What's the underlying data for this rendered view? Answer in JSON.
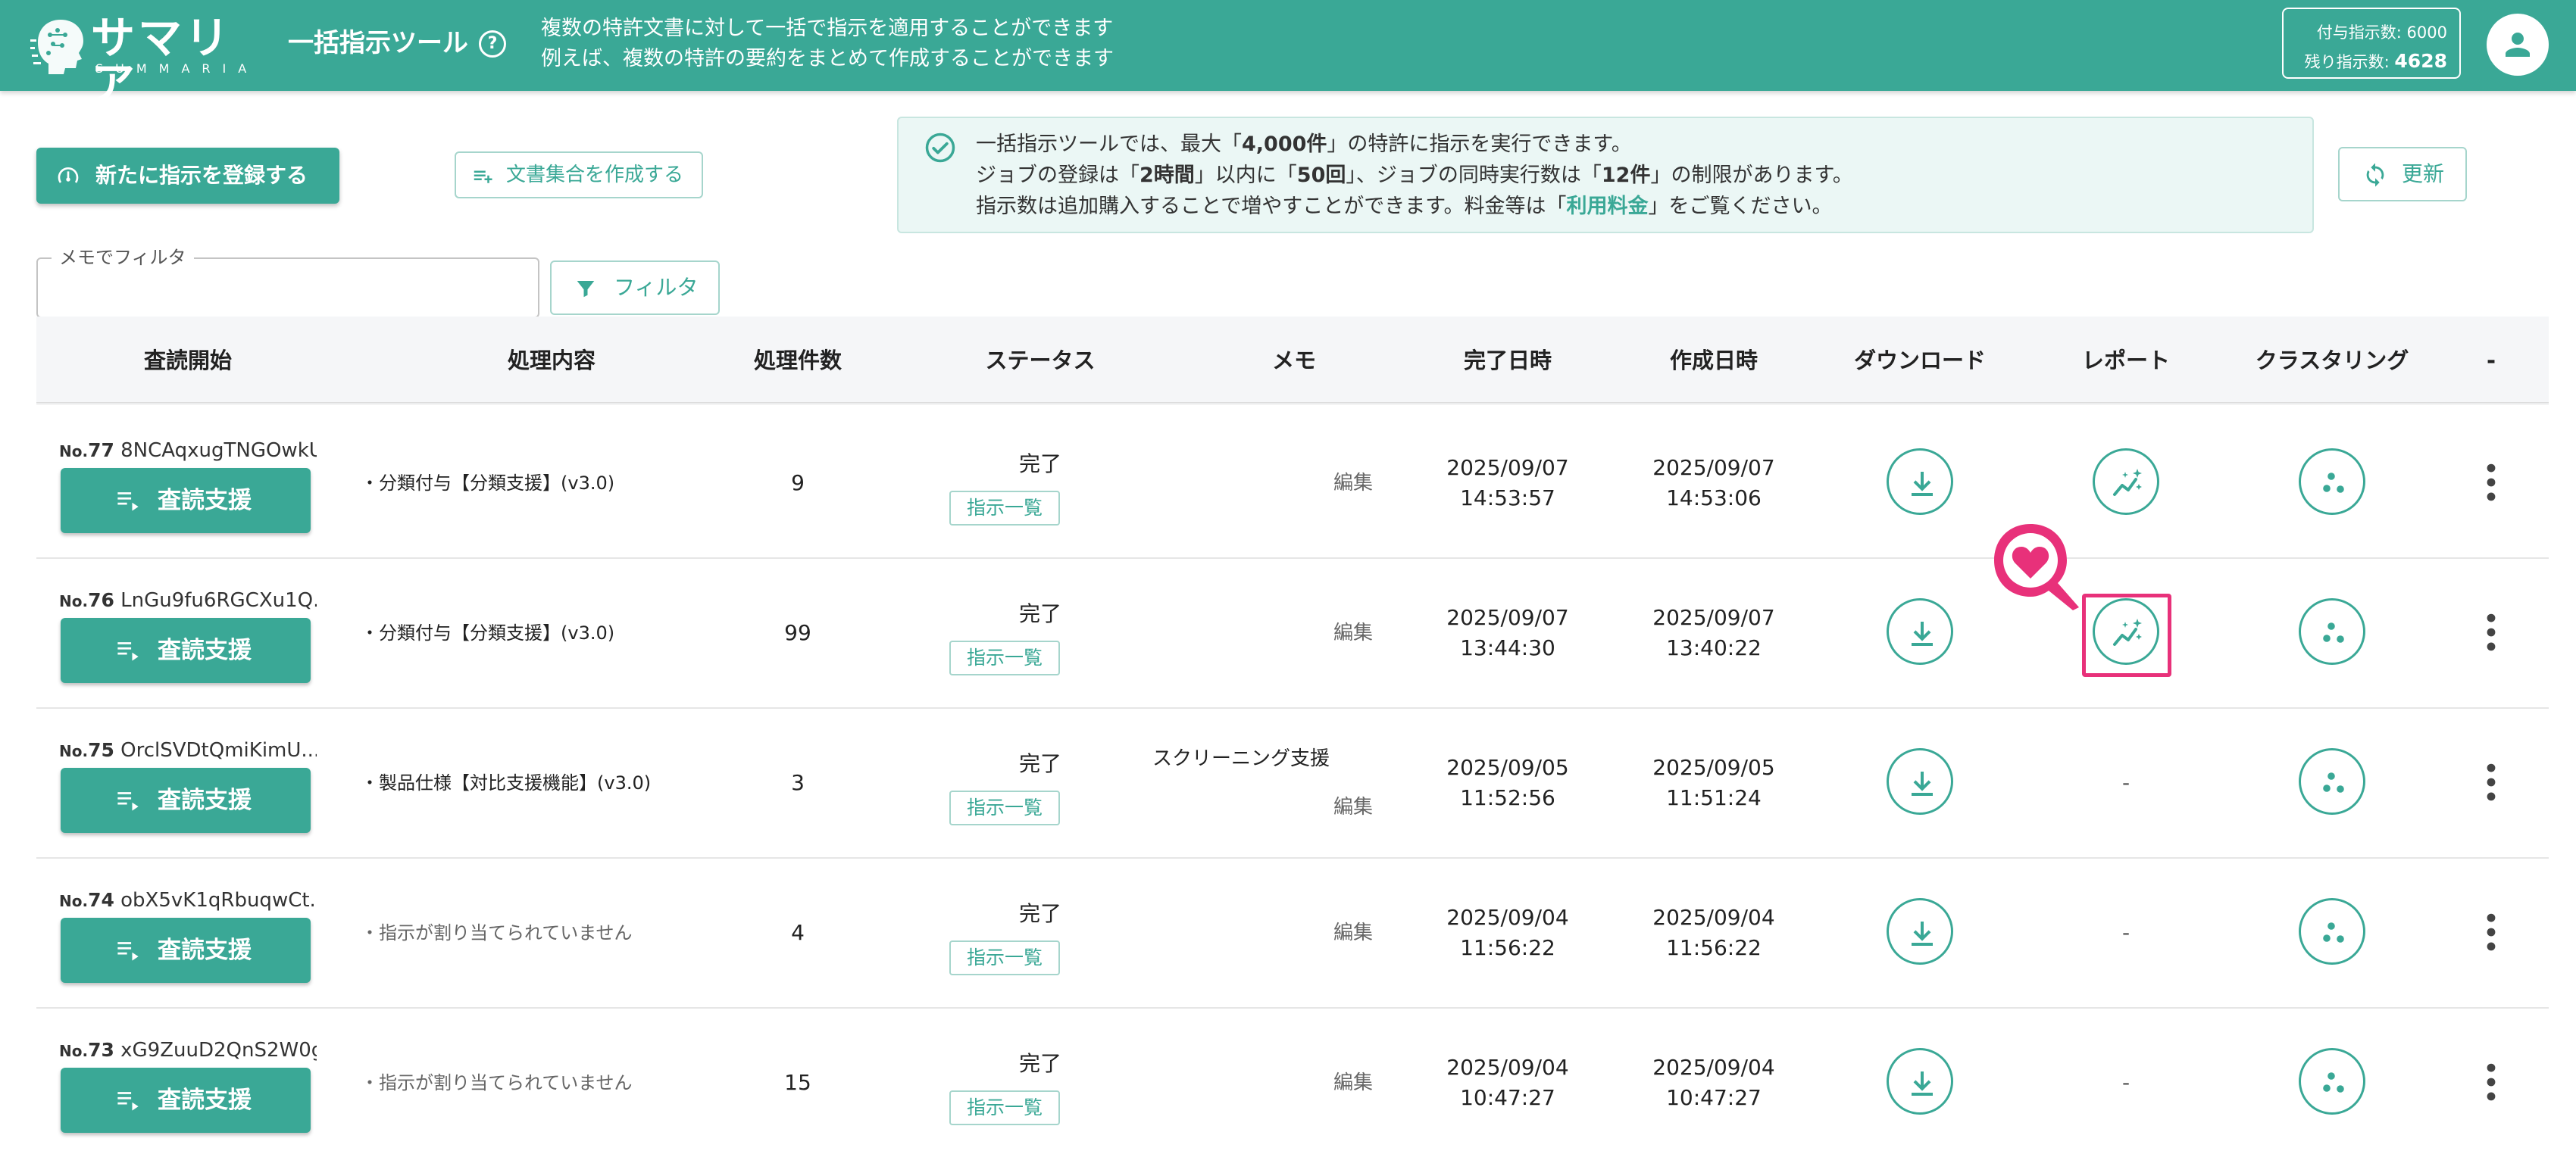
{
  "header": {
    "logo_text": "サマリア",
    "logo_sub": "SUMMARIA",
    "tool_title": "一括指示ツール",
    "help_glyph": "?",
    "description_line1": "複数の特許文書に対して一括で指示を適用することができます",
    "description_line2": "例えば、複数の特許の要約をまとめて作成することができます",
    "quota_granted_label": "付与指示数: ",
    "quota_granted_value": "6000",
    "quota_remaining_label": "残り指示数: ",
    "quota_remaining_value": "4628"
  },
  "toolbar": {
    "register_button": "新たに指示を登録する",
    "docset_button": "文書集合を作成する",
    "refresh_button": "更新"
  },
  "notice": {
    "l1_a": "一括指示ツールでは、最大「",
    "l1_b": "4,000件",
    "l1_c": "」の特許に指示を実行できます。",
    "l2_a": "ジョブの登録は「",
    "l2_b": "2時間",
    "l2_c": "」以内に「",
    "l2_d": "50回",
    "l2_e": "」、ジョブの同時実行数は「",
    "l2_f": "12件",
    "l2_g": "」の制限があります。",
    "l3_a": "指示数は追加購入することで増やすことができます。料金等は「",
    "l3_link": "利用料金",
    "l3_c": "」をご覧ください。"
  },
  "filter": {
    "label": "メモでフィルタ",
    "value": "",
    "button": "フィルタ"
  },
  "table": {
    "columns": [
      "査読開始",
      "処理内容",
      "処理件数",
      "ステータス",
      "メモ",
      "完了日時",
      "作成日時",
      "ダウンロード",
      "レポート",
      "クラスタリング",
      "-"
    ],
    "review_label": "査読支援",
    "instructions_label": "指示一覧",
    "edit_label": "編集",
    "no_prefix": "No.",
    "rows": [
      {
        "no": "77",
        "id": "8NCAqxugTNGOwkU...",
        "process": "・分類付与【分類支援】(v3.0)",
        "count": "9",
        "status": "完了",
        "memo": "",
        "done_date": "2025/09/07",
        "done_time": "14:53:57",
        "created_date": "2025/09/07",
        "created_time": "14:53:06",
        "report": "-"
      },
      {
        "no": "76",
        "id": "LnGu9fu6RGCXu1Q...",
        "process": "・分類付与【分類支援】(v3.0)",
        "count": "99",
        "status": "完了",
        "memo": "",
        "done_date": "2025/09/07",
        "done_time": "13:44:30",
        "created_date": "2025/09/07",
        "created_time": "13:40:22",
        "report": "-"
      },
      {
        "no": "75",
        "id": "OrclSVDtQmiKimU...",
        "process": "・製品仕様【対比支援機能】(v3.0)",
        "count": "3",
        "status": "完了",
        "memo": "スクリーニング支援",
        "done_date": "2025/09/05",
        "done_time": "11:52:56",
        "created_date": "2025/09/05",
        "created_time": "11:51:24",
        "report": "-"
      },
      {
        "no": "74",
        "id": "obX5vK1qRbuqwCt...",
        "process": "・指示が割り当てられていません",
        "count": "4",
        "status": "完了",
        "memo": "",
        "done_date": "2025/09/04",
        "done_time": "11:56:22",
        "created_date": "2025/09/04",
        "created_time": "11:56:22",
        "report": "-"
      },
      {
        "no": "73",
        "id": "xG9ZuuD2QnS2W0g...",
        "process": "・指示が割り当てられていません",
        "count": "15",
        "status": "完了",
        "memo": "",
        "done_date": "2025/09/04",
        "done_time": "10:47:27",
        "created_date": "2025/09/04",
        "created_time": "10:47:27",
        "report": "-"
      }
    ]
  },
  "colors": {
    "brand": "#3aa896",
    "highlight": "#e8317a",
    "notice_bg": "#ebf7f5"
  }
}
